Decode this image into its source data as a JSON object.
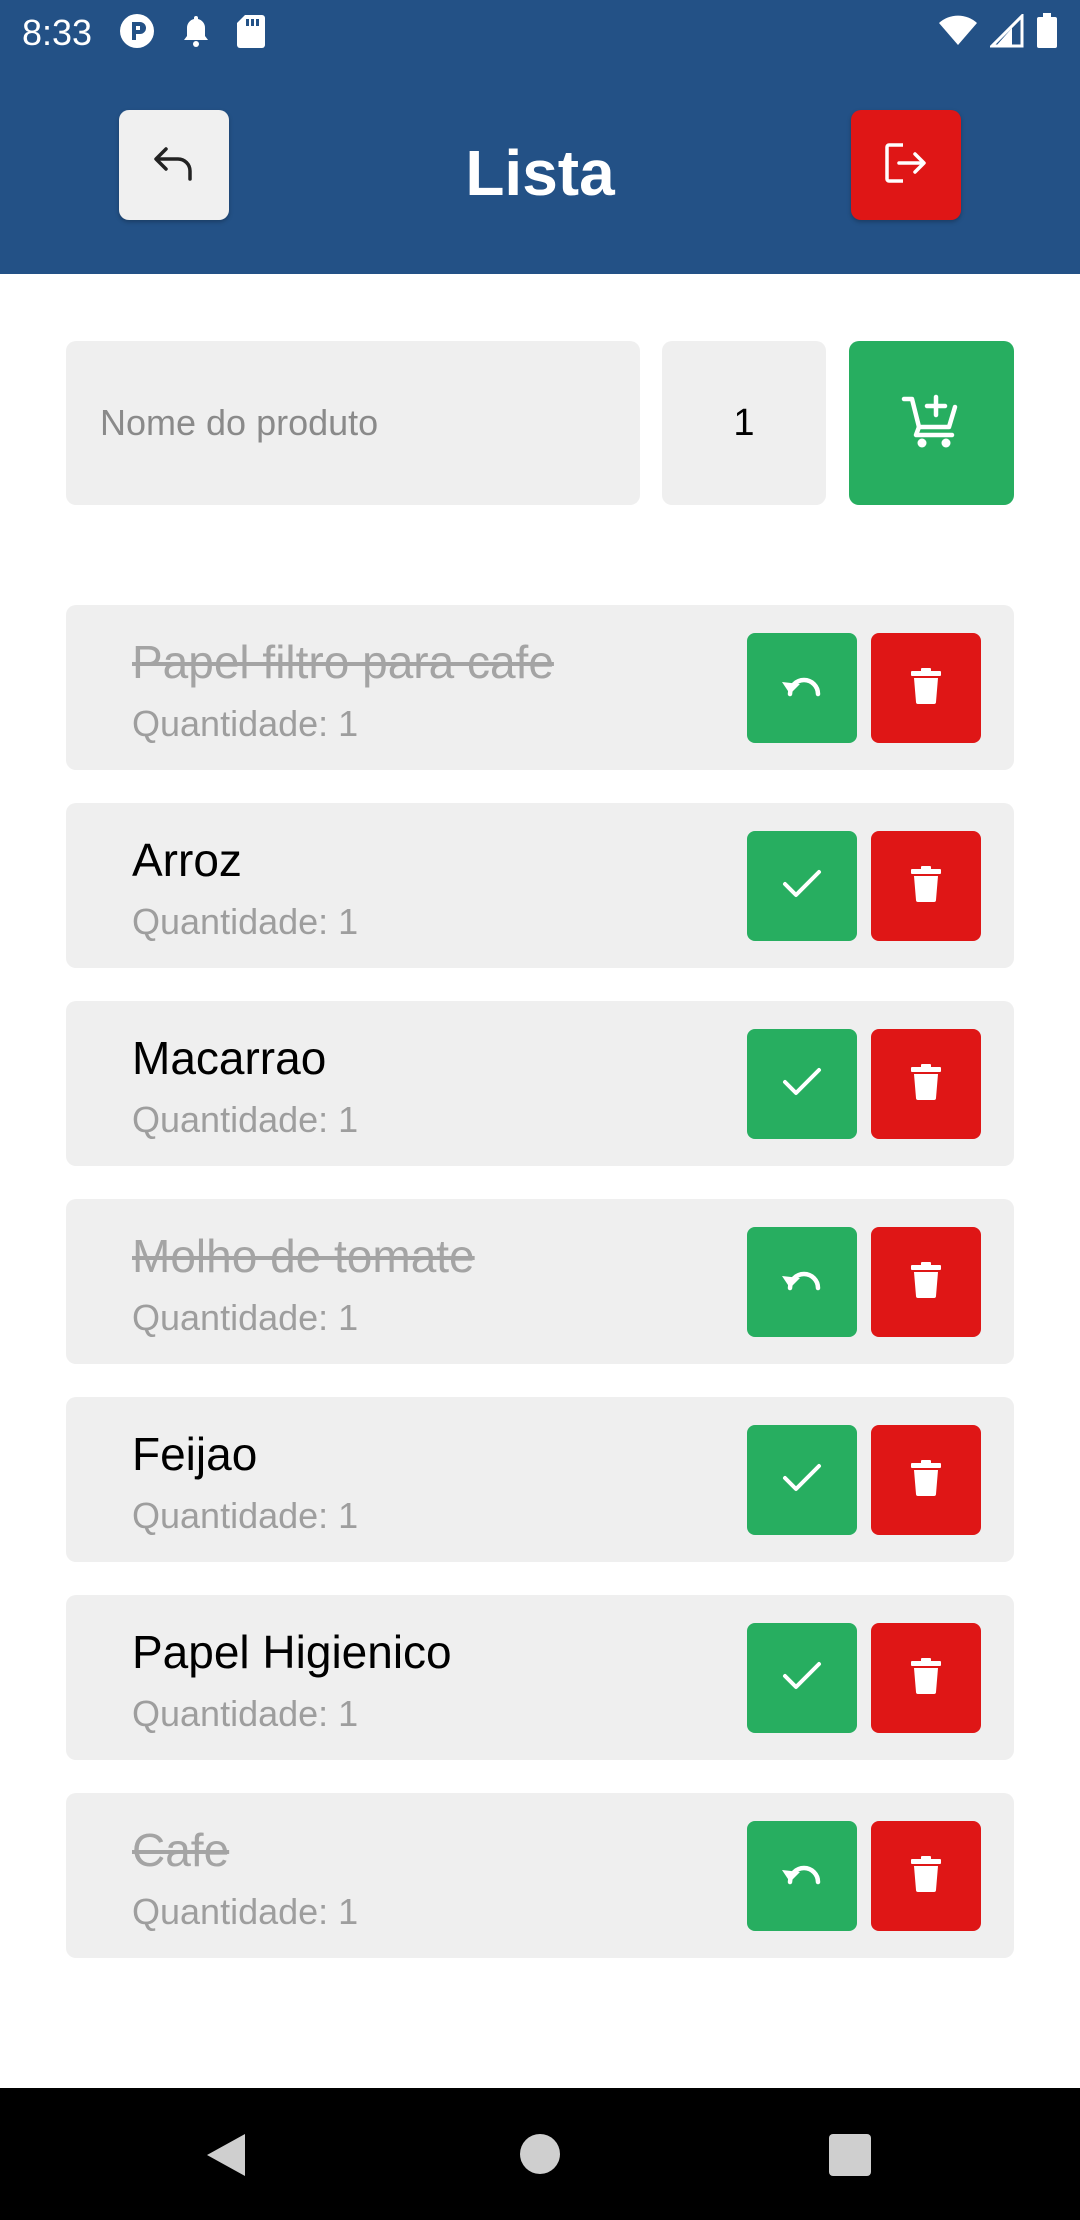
{
  "status_bar": {
    "time": "8:33",
    "left_icons": [
      "app-p-icon",
      "notification-bell-icon",
      "sd-card-icon"
    ],
    "right_icons": [
      "wifi-icon",
      "cell-signal-icon",
      "battery-icon"
    ]
  },
  "header": {
    "title": "Lista",
    "back_icon": "undo-arrow-icon",
    "logout_icon": "logout-icon"
  },
  "add_form": {
    "name_placeholder": "Nome do produto",
    "name_value": "",
    "quantity_value": "1",
    "add_icon": "add-to-cart-icon"
  },
  "items": [
    {
      "name": "Papel filtro para cafe",
      "quantity_label": "Quantidade: 1",
      "done": true
    },
    {
      "name": "Arroz",
      "quantity_label": "Quantidade: 1",
      "done": false
    },
    {
      "name": "Macarrao",
      "quantity_label": "Quantidade: 1",
      "done": false
    },
    {
      "name": "Molho de tomate",
      "quantity_label": "Quantidade: 1",
      "done": true
    },
    {
      "name": "Feijao",
      "quantity_label": "Quantidade: 1",
      "done": false
    },
    {
      "name": "Papel Higienico",
      "quantity_label": "Quantidade: 1",
      "done": false
    },
    {
      "name": "Cafe",
      "quantity_label": "Quantidade: 1",
      "done": true
    }
  ],
  "colors": {
    "header_bg": "#235186",
    "green": "#27ae60",
    "red": "#df1616",
    "field_bg": "#efefef"
  },
  "nav_bar": {
    "icons": [
      "back-triangle-icon",
      "home-circle-icon",
      "recents-square-icon"
    ]
  }
}
